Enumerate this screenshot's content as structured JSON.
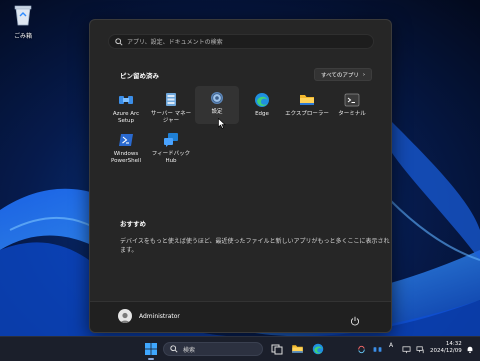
{
  "desktop": {
    "recycle_bin_label": "ごみ箱"
  },
  "start_menu": {
    "search_placeholder": "アプリ、設定、ドキュメントの検索",
    "pinned_title": "ピン留め済み",
    "all_apps_label": "すべてのアプリ",
    "pinned_apps": [
      {
        "label": "Azure Arc Setup",
        "icon": "azure-arc-icon"
      },
      {
        "label": "サーバー マネージャー",
        "icon": "server-manager-icon"
      },
      {
        "label": "設定",
        "icon": "settings-gear-icon"
      },
      {
        "label": "Edge",
        "icon": "edge-icon"
      },
      {
        "label": "エクスプローラー",
        "icon": "folder-icon"
      },
      {
        "label": "ターミナル",
        "icon": "terminal-icon"
      },
      {
        "label": "Windows PowerShell",
        "icon": "powershell-icon"
      },
      {
        "label": "フィードバック Hub",
        "icon": "feedback-hub-icon"
      }
    ],
    "recommended_title": "おすすめ",
    "recommended_text": "デバイスをもっと使えば使うほど、最近使ったファイルと新しいアプリがもっと多くここに表示されます。",
    "user_name": "Administrator"
  },
  "taskbar": {
    "search_label": "検索",
    "tray_lang": "A",
    "time": "14:32",
    "date": "2024/12/09"
  },
  "colors": {
    "accent": "#4aa3ff",
    "menu_bg": "#262626"
  }
}
